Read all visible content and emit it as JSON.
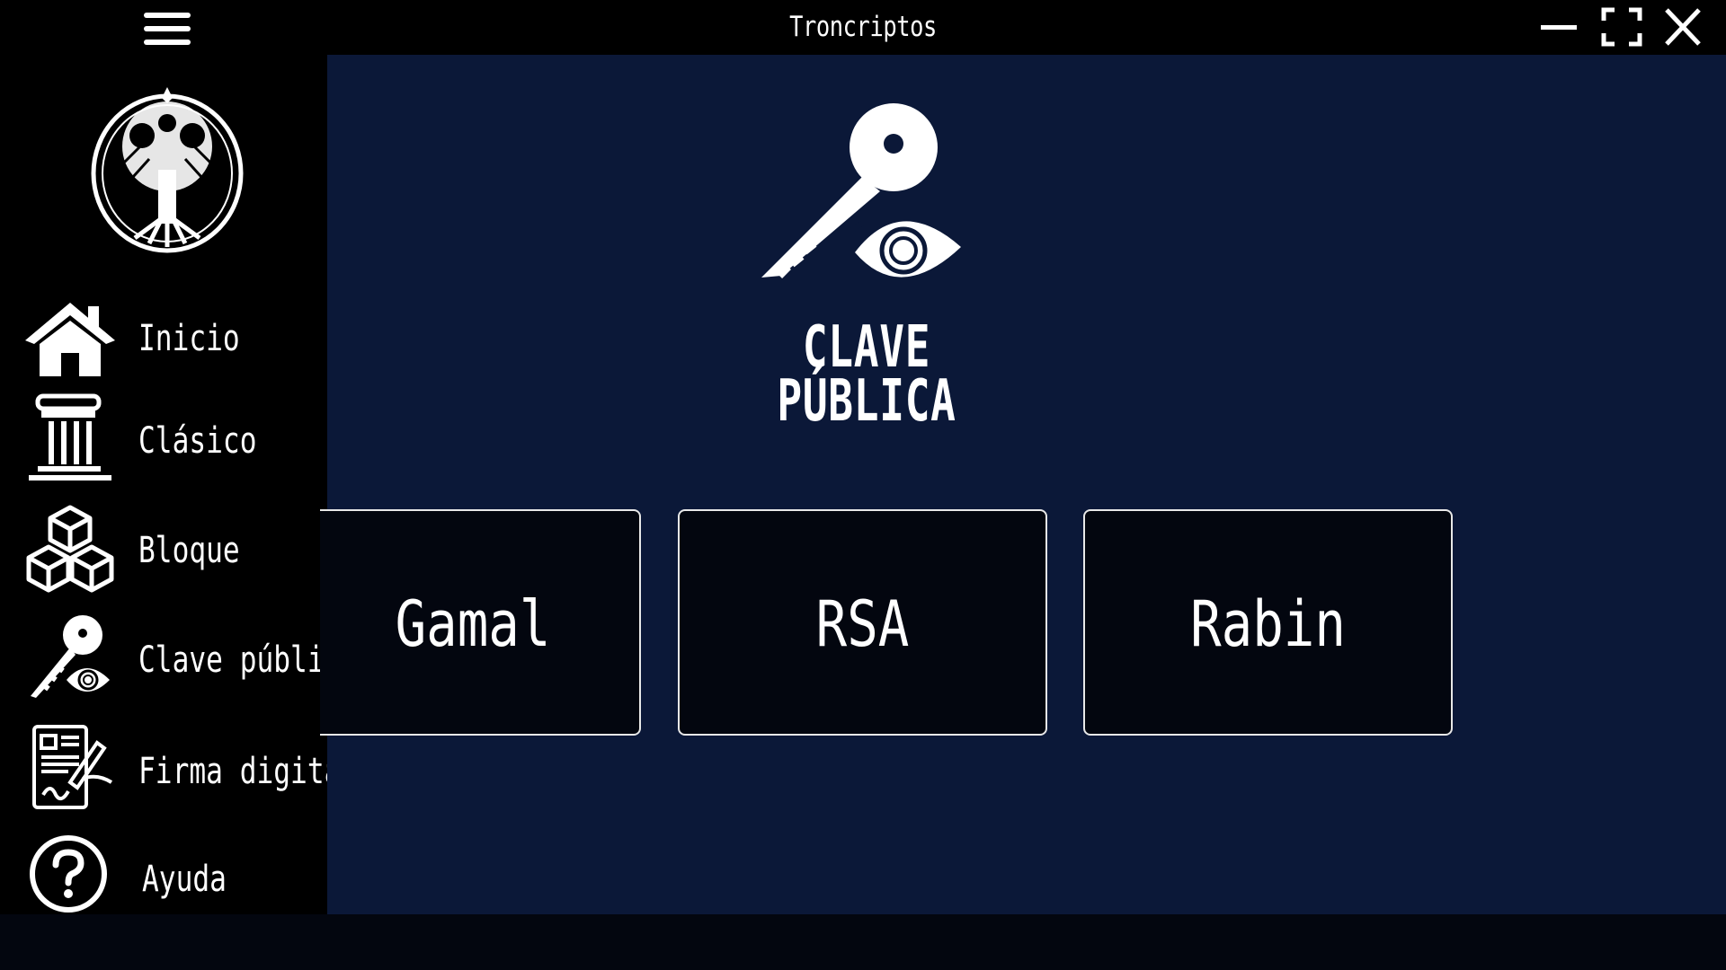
{
  "window": {
    "title": "Troncriptos"
  },
  "sidebar": {
    "items": [
      {
        "label": "Inicio",
        "icon": "home-icon"
      },
      {
        "label": "Clásico",
        "icon": "column-icon"
      },
      {
        "label": "Bloque",
        "icon": "cubes-icon"
      },
      {
        "label": "Clave pública",
        "icon": "key-eye-icon"
      },
      {
        "label": "Firma digital",
        "icon": "signature-document-icon"
      },
      {
        "label": "Ayuda",
        "icon": "help-icon"
      }
    ]
  },
  "main": {
    "hero_line1": "CLAVE",
    "hero_line2": "PÚBLICA",
    "cards": [
      {
        "label": "Gamal"
      },
      {
        "label": "RSA"
      },
      {
        "label": "Rabin"
      }
    ]
  },
  "colors": {
    "titlebar": "#000000",
    "sidebar": "#000000",
    "main_background": "#0b1838",
    "card_background": "#03060f",
    "card_border": "#e8e8e8",
    "text": "#ffffff"
  }
}
